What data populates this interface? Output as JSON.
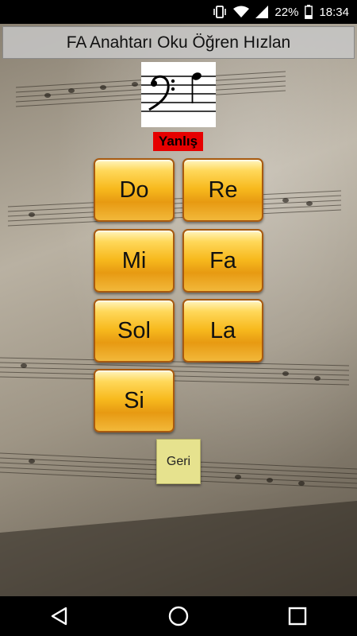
{
  "status_bar": {
    "battery_percent": "22%",
    "time": "18:34",
    "icons": [
      "vibrate-icon",
      "wifi-icon",
      "signal-icon",
      "battery-icon"
    ]
  },
  "app": {
    "title": "FA Anahtarı Oku Öğren Hızlan"
  },
  "quiz": {
    "clef_image": "bass-clef-note-icon",
    "result_text": "Yanlış",
    "result_color": "#e60000"
  },
  "notes": [
    {
      "label": "Do"
    },
    {
      "label": "Re"
    },
    {
      "label": "Mi"
    },
    {
      "label": "Fa"
    },
    {
      "label": "Sol"
    },
    {
      "label": "La"
    },
    {
      "label": "Si"
    }
  ],
  "back_button": {
    "label": "Geri"
  },
  "nav_bar": {
    "icons": [
      "back-triangle-icon",
      "home-circle-icon",
      "recents-square-icon"
    ]
  },
  "colors": {
    "button_gold": "#f7b91d",
    "button_border": "#a85a10",
    "back_button_bg": "#e6e28e"
  }
}
